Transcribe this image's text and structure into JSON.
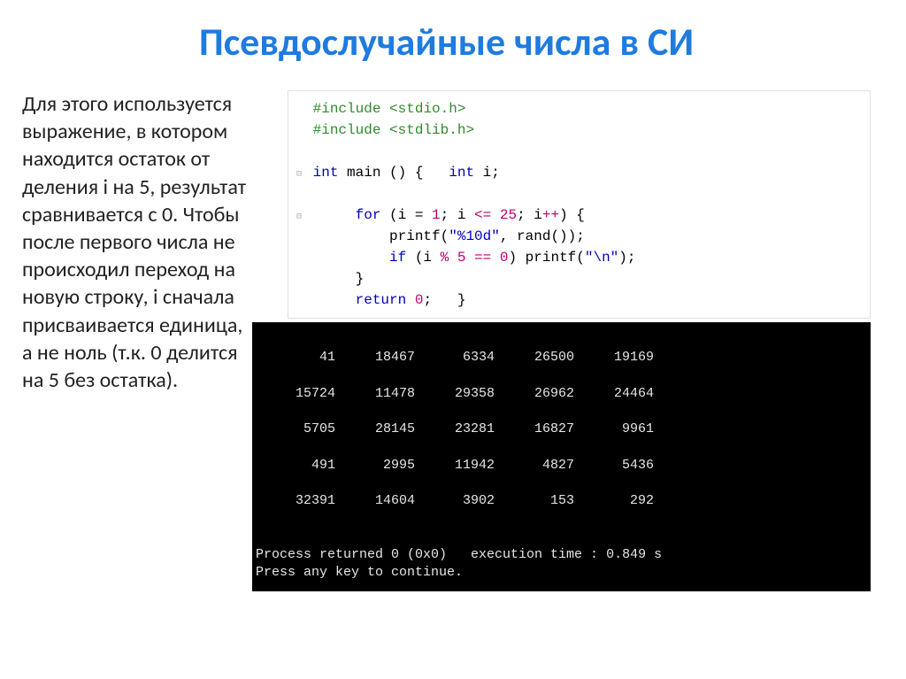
{
  "title": "Псевдослучайные числа в СИ",
  "paragraph": "Для этого используется выражение, в котором находится остаток от деления i на 5, результат сравнивается с 0. Чтобы после первого числа не происходил переход на новую строку, i сначала присваивается единица, а не ноль (т.к. 0 делится на 5 без остатка).",
  "code": {
    "l1a": "#include ",
    "l1b": "<stdio.h>",
    "l2a": "#include ",
    "l2b": "<stdlib.h>",
    "l3_kw1": "int",
    "l3_fn": " main ",
    "l3_p": "() {   ",
    "l3_kw2": "int",
    "l3_rest": " i;",
    "l4_kw": "for",
    "l4_a": " (i = ",
    "l4_n1": "1",
    "l4_b": "; i ",
    "l4_op": "<= ",
    "l4_n2": "25",
    "l4_c": "; i",
    "l4_inc": "++",
    "l4_d": ") {",
    "l5_fn": "printf",
    "l5_a": "(",
    "l5_str": "\"%10d\"",
    "l5_b": ", rand());",
    "l6_kw": "if",
    "l6_a": " (i ",
    "l6_op": "% ",
    "l6_n1": "5",
    "l6_eq": " == ",
    "l6_n2": "0",
    "l6_b": ") printf(",
    "l6_str": "\"\\n\"",
    "l6_c": ");",
    "l7": "}",
    "l8_kw": "return",
    "l8_rest": " ",
    "l8_n": "0",
    "l8_end": ";   }"
  },
  "console": {
    "rows": [
      [
        "41",
        "18467",
        "6334",
        "26500",
        "19169"
      ],
      [
        "15724",
        "11478",
        "29358",
        "26962",
        "24464"
      ],
      [
        "5705",
        "28145",
        "23281",
        "16827",
        "9961"
      ],
      [
        "491",
        "2995",
        "11942",
        "4827",
        "5436"
      ],
      [
        "32391",
        "14604",
        "3902",
        "153",
        "292"
      ]
    ],
    "status_line": "Process returned 0 (0x0)   execution time : 0.849 s",
    "prompt_line": "Press any key to continue."
  },
  "chart_data": {
    "type": "table",
    "title": "Program output (pseudo-random numbers, 5×5)",
    "rows": [
      [
        41,
        18467,
        6334,
        26500,
        19169
      ],
      [
        15724,
        11478,
        29358,
        26962,
        24464
      ],
      [
        5705,
        28145,
        23281,
        16827,
        9961
      ],
      [
        491,
        2995,
        11942,
        4827,
        5436
      ],
      [
        32391,
        14604,
        3902,
        153,
        292
      ]
    ]
  }
}
